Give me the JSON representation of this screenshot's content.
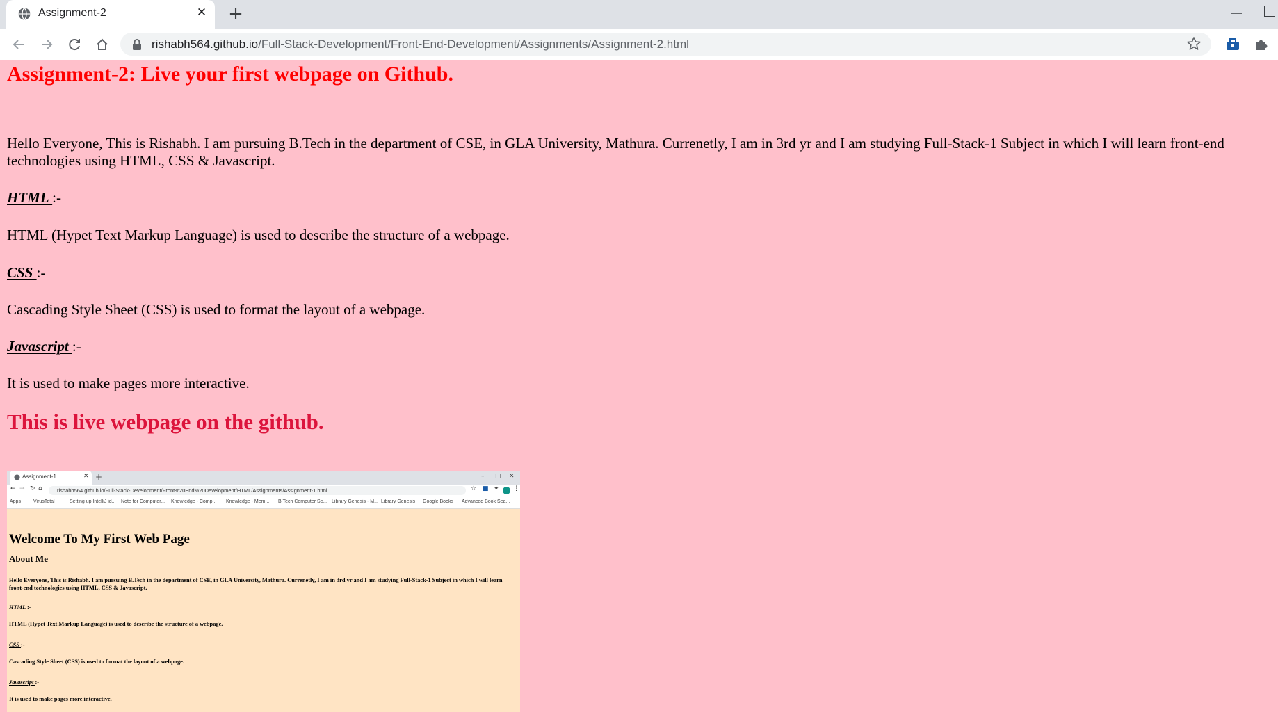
{
  "browser": {
    "tab_title": "Assignment-2",
    "tab_close": "✕",
    "new_tab": "+",
    "url_domain": "rishabh564.github.io",
    "url_path": "/Full-Stack-Development/Front-End-Development/Assignments/Assignment-2.html"
  },
  "page": {
    "title": "Assignment-2: Live your first webpage on Github.",
    "intro": "Hello Everyone, This is Rishabh. I am pursuing B.Tech in the department of CSE, in GLA University, Mathura. Currenetly, I am in 3rd yr and I am studying Full-Stack-1 Subject in which I will learn front-end technologies using HTML, CSS & Javascript.",
    "sections": [
      {
        "heading": "HTML ",
        "suffix": ":-",
        "text": "HTML (Hypet Text Markup Language) is used to describe the structure of a webpage."
      },
      {
        "heading": "CSS ",
        "suffix": ":-",
        "text": "Cascading Style Sheet (CSS) is used to format the layout of a webpage."
      },
      {
        "heading": "Javascript ",
        "suffix": ":-",
        "text": "It is used to make pages more interactive."
      }
    ],
    "live_heading": "This is live webpage on the github."
  },
  "screenshot": {
    "tab_title": "Assignment-1",
    "url": "rishabh564.github.io/Full-Stack-Development/Front%20End%20Development/HTML/Assignments/Assignment-1.html",
    "bookmarks": [
      "Apps",
      "VirusTotal",
      "Setting up IntelliJ id...",
      "Note for Computer...",
      "Knowledge - Comp...",
      "Knowledge - Mem...",
      "B.Tech Computer Sc...",
      "Library Genesis - M...",
      "Library Genesis",
      "Google Books",
      "Advanced Book Sea..."
    ],
    "title": "Welcome To My First Web Page",
    "about": "About Me",
    "intro": "Hello Everyone, This is Rishabh. I am pursuing B.Tech in the department of CSE, in GLA University, Mathura. Currenetly, I am in 3rd yr and I am studying Full-Stack-1 Subject in which I will learn front-end technologies using HTML, CSS & Javascript.",
    "sections": [
      {
        "heading": "HTML ",
        "suffix": ":-",
        "text": "HTML (Hypet Text Markup Language) is used to describe the structure of a webpage."
      },
      {
        "heading": "CSS ",
        "suffix": ":-",
        "text": "Cascading Style Sheet (CSS) is used to format the layout of a webpage."
      },
      {
        "heading": "Javascript ",
        "suffix": ":-",
        "text": "It is used to make pages more interactive."
      }
    ]
  },
  "colors": {
    "page_bg": "#ffc0cb",
    "title": "#ff0000",
    "live_heading": "#dc143c",
    "screenshot_bg": "#ffe4c4"
  }
}
